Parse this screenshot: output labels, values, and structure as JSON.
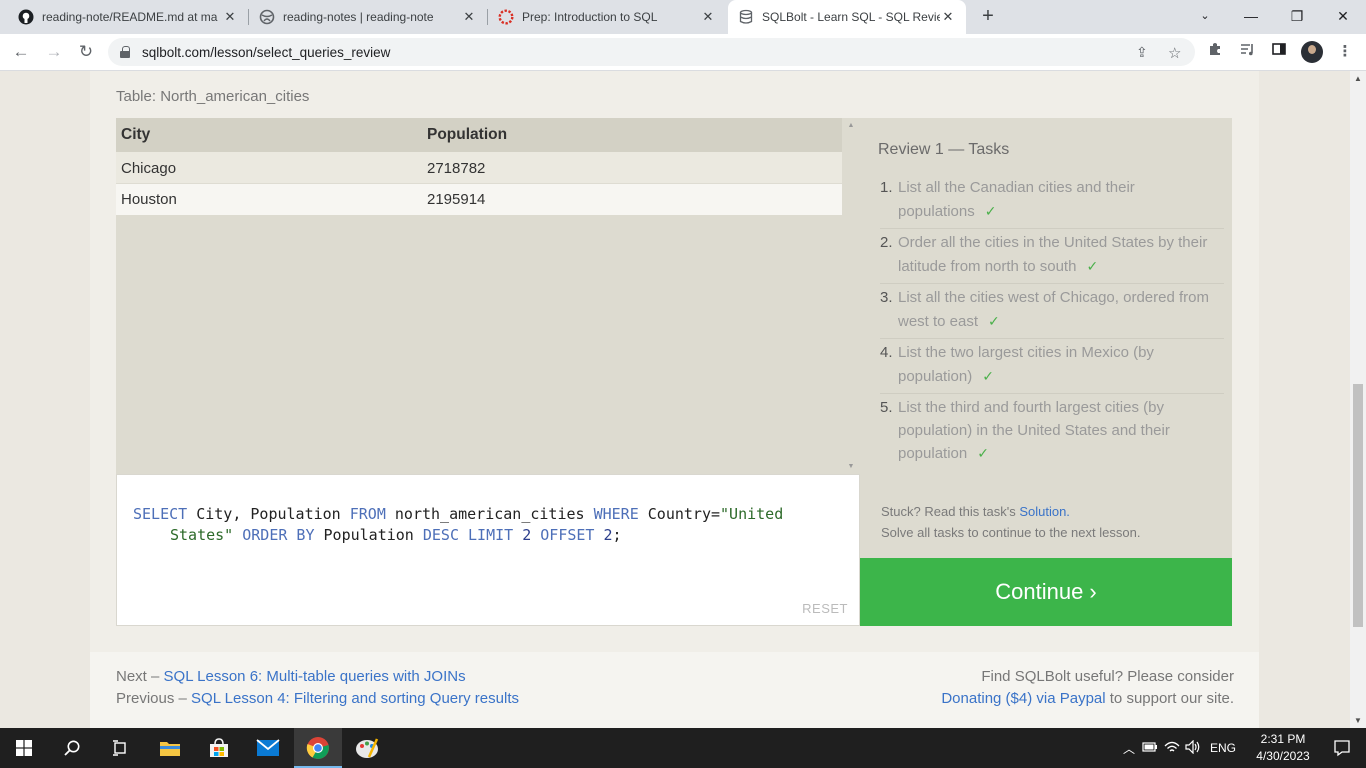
{
  "browser": {
    "tabs": [
      {
        "title": "reading-note/README.md at ma",
        "icon": "github-icon",
        "active": false
      },
      {
        "title": "reading-notes | reading-note",
        "icon": "globe-icon",
        "active": false
      },
      {
        "title": "Prep: Introduction to SQL",
        "icon": "ring-icon",
        "active": false
      },
      {
        "title": "SQLBolt - Learn SQL - SQL Revie",
        "icon": "database-icon",
        "active": true
      }
    ],
    "url": "sqlbolt.com/lesson/select_queries_review"
  },
  "page": {
    "table_caption": "Table: North_american_cities",
    "results": {
      "columns": [
        "City",
        "Population"
      ],
      "rows": [
        [
          "Chicago",
          "2718782"
        ],
        [
          "Houston",
          "2195914"
        ]
      ]
    },
    "query": {
      "line1": [
        {
          "t": "SELECT",
          "k": "kw"
        },
        {
          "t": " City, Population ",
          "k": ""
        },
        {
          "t": "FROM",
          "k": "kw"
        },
        {
          "t": " north_american_cities ",
          "k": ""
        },
        {
          "t": "WHERE",
          "k": "kw"
        },
        {
          "t": " Country=",
          "k": ""
        },
        {
          "t": "\"United",
          "k": "str"
        }
      ],
      "line2": [
        {
          "t": "States\"",
          "k": "str"
        },
        {
          "t": " ",
          "k": ""
        },
        {
          "t": "ORDER BY",
          "k": "kw"
        },
        {
          "t": " Population ",
          "k": ""
        },
        {
          "t": "DESC",
          "k": "kw"
        },
        {
          "t": " ",
          "k": ""
        },
        {
          "t": "LIMIT",
          "k": "kw"
        },
        {
          "t": " ",
          "k": ""
        },
        {
          "t": "2",
          "k": "num"
        },
        {
          "t": " ",
          "k": ""
        },
        {
          "t": "OFFSET",
          "k": "kw"
        },
        {
          "t": " ",
          "k": ""
        },
        {
          "t": "2",
          "k": "num"
        },
        {
          "t": ";",
          "k": ""
        }
      ]
    },
    "reset_label": "RESET",
    "tasks_title": "Review 1 — Tasks",
    "tasks": [
      {
        "num": "1.",
        "text": "List all the Canadian cities and their populations"
      },
      {
        "num": "2.",
        "text": "Order all the cities in the United States by their latitude from north to south"
      },
      {
        "num": "3.",
        "text": "List all the cities west of Chicago, ordered from west to east"
      },
      {
        "num": "4.",
        "text": "List the two largest cities in Mexico (by population)"
      },
      {
        "num": "5.",
        "text": "List the third and fourth largest cities (by population) in the United States and their population"
      }
    ],
    "check_mark": "✓",
    "stuck_prefix": "Stuck? Read this task's ",
    "stuck_link": "Solution.",
    "stuck_line2": "Solve all tasks to continue to the next lesson.",
    "continue_label": "Continue ›",
    "footer": {
      "next_prefix": "Next – ",
      "next_link": "SQL Lesson 6: Multi-table queries with JOINs",
      "prev_prefix": "Previous – ",
      "prev_link": "SQL Lesson 4: Filtering and sorting Query results",
      "useful": "Find SQLBolt useful? Please consider",
      "donate_link": "Donating ($4) via Paypal",
      "donate_suffix": " to support our site."
    }
  },
  "taskbar": {
    "tray_lang": "ENG",
    "time": "2:31 PM",
    "date": "4/30/2023"
  },
  "colors": {
    "accent_green": "#3cb54a",
    "link_blue": "#3a73c8",
    "keyword_blue": "#4d6fb8"
  }
}
